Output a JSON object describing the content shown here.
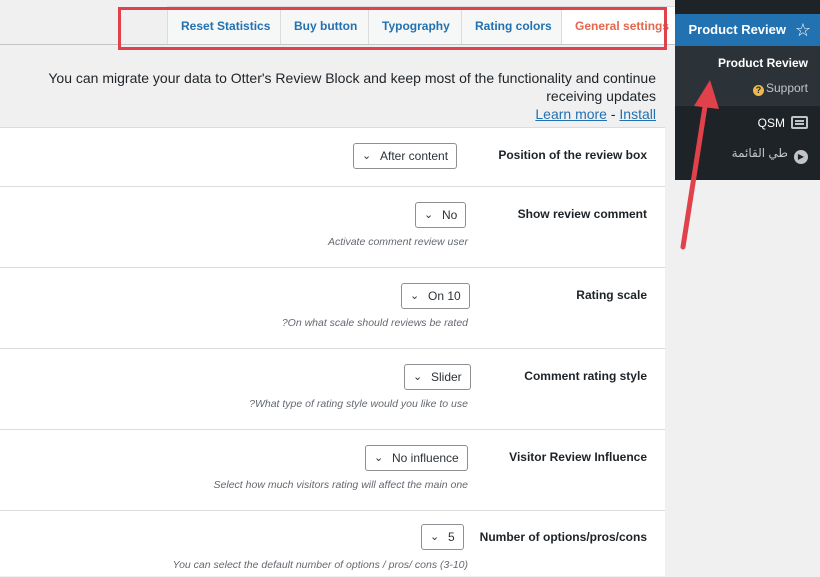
{
  "tabs": [
    {
      "label": "Reset Statistics",
      "active": false
    },
    {
      "label": "Buy button",
      "active": false
    },
    {
      "label": "Typography",
      "active": false
    },
    {
      "label": "Rating colors",
      "active": false
    },
    {
      "label": "General settings",
      "active": true
    }
  ],
  "notice": {
    "message": "You can migrate your data to Otter's Review Block and keep most of the functionality and continue receiving updates",
    "learn_more": "Learn more",
    "separator": " - ",
    "install": "Install"
  },
  "settings": [
    {
      "label": "Position of the review box",
      "value": "After content",
      "hint": ""
    },
    {
      "label": "Show review comment",
      "value": "No",
      "hint": "Activate comment review user"
    },
    {
      "label": "Rating scale",
      "value": "On 10",
      "hint": "?On what scale should reviews be rated"
    },
    {
      "label": "Comment rating style",
      "value": "Slider",
      "hint": "?What type of rating style would you like to use"
    },
    {
      "label": "Visitor Review Influence",
      "value": "No influence",
      "hint": "Select how much visitors rating will affect the main one"
    },
    {
      "label": "Number of options/pros/cons",
      "value": "5",
      "hint": "You can select the default number of options / pros/ cons (3-10)"
    }
  ],
  "sidebar": {
    "menu_title": "Product Review",
    "submenu_current": "Product Review",
    "submenu_support": "Support",
    "qsm": "QSM",
    "arabic_item": "طي القائمة"
  },
  "colors": {
    "accent": "#2271b1",
    "active_tab": "#e5674d",
    "highlight": "#e0414a",
    "sidebar_bg": "#1d2327"
  }
}
